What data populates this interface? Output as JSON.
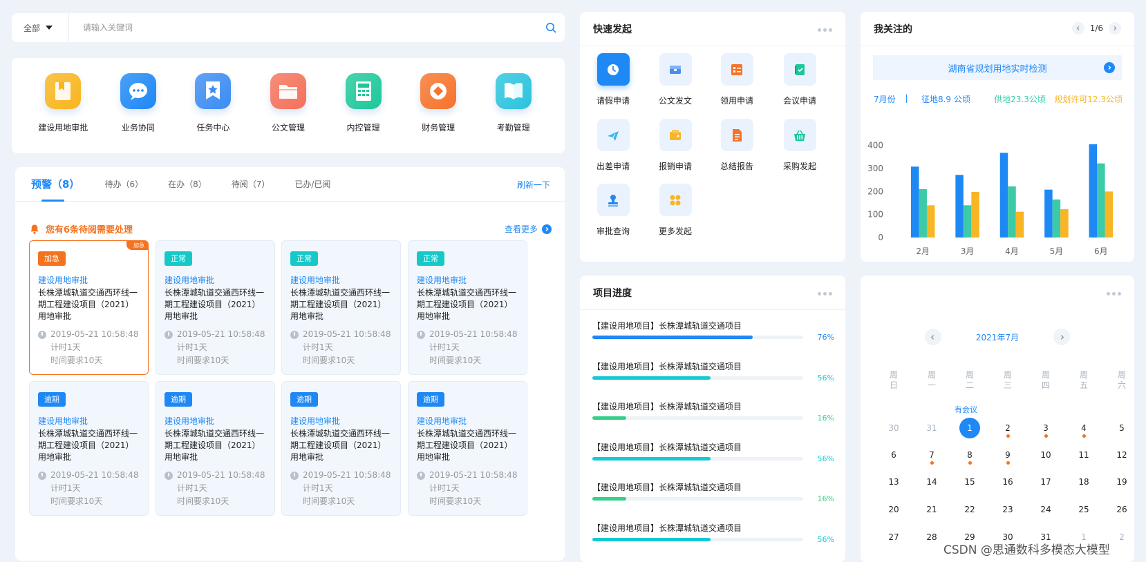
{
  "search": {
    "scope": "全部",
    "placeholder": "请输入关键词"
  },
  "apps": [
    {
      "label": "建设用地审批",
      "icon": "bookmark-icon",
      "color": "#f8b51e"
    },
    {
      "label": "业务协同",
      "icon": "chat-icon",
      "color": "#1e88f5"
    },
    {
      "label": "任务中心",
      "icon": "star-icon",
      "color": "#3b8cf3"
    },
    {
      "label": "公文管理",
      "icon": "folder-icon",
      "color": "#f4715a"
    },
    {
      "label": "内控管理",
      "icon": "calculator-icon",
      "color": "#1cc89a"
    },
    {
      "label": "财务管理",
      "icon": "coin-icon",
      "color": "#f6732b"
    },
    {
      "label": "考勤管理",
      "icon": "book-icon",
      "color": "#2ac3dd"
    }
  ],
  "tasks": {
    "tabs": [
      "预警（8）",
      "待办（6）",
      "在办（8）",
      "待阅（7）",
      "已办/已阅"
    ],
    "refresh": "刷新一下",
    "notice": "您有6条待阅需要处理",
    "more": "查看更多",
    "corner": "加急",
    "cards": [
      {
        "badge": "加急",
        "title": "建设用地审批",
        "desc": "长株潭城轨道交通西环线一期工程建设项目（2021）用地审批",
        "time": "2019-05-21 10:58:48",
        "elapsed": "计时1天",
        "req": "时间要求10天"
      },
      {
        "badge": "正常",
        "title": "建设用地审批",
        "desc": "长株潭城轨道交通西环线一期工程建设项目（2021）用地审批",
        "time": "2019-05-21 10:58:48",
        "elapsed": "计时1天",
        "req": "时间要求10天"
      },
      {
        "badge": "正常",
        "title": "建设用地审批",
        "desc": "长株潭城轨道交通西环线一期工程建设项目（2021）用地审批",
        "time": "2019-05-21 10:58:48",
        "elapsed": "计时1天",
        "req": "时间要求10天"
      },
      {
        "badge": "正常",
        "title": "建设用地审批",
        "desc": "长株潭城轨道交通西环线一期工程建设项目（2021）用地审批",
        "time": "2019-05-21 10:58:48",
        "elapsed": "计时1天",
        "req": "时间要求10天"
      },
      {
        "badge": "逾期",
        "title": "建设用地审批",
        "desc": "长株潭城轨道交通西环线一期工程建设项目（2021）用地审批",
        "time": "2019-05-21 10:58:48",
        "elapsed": "计时1天",
        "req": "时间要求10天"
      },
      {
        "badge": "逾期",
        "title": "建设用地审批",
        "desc": "长株潭城轨道交通西环线一期工程建设项目（2021）用地审批",
        "time": "2019-05-21 10:58:48",
        "elapsed": "计时1天",
        "req": "时间要求10天"
      },
      {
        "badge": "逾期",
        "title": "建设用地审批",
        "desc": "长株潭城轨道交通西环线一期工程建设项目（2021）用地审批",
        "time": "2019-05-21 10:58:48",
        "elapsed": "计时1天",
        "req": "时间要求10天"
      },
      {
        "badge": "逾期",
        "title": "建设用地审批",
        "desc": "长株潭城轨道交通西环线一期工程建设项目（2021）用地审批",
        "time": "2019-05-21 10:58:48",
        "elapsed": "计时1天",
        "req": "时间要求10天"
      }
    ]
  },
  "badge_colors": {
    "加急": "#f5731e",
    "正常": "#15c9c9",
    "逾期": "#1e88f5"
  },
  "quick": {
    "title": "快速发起",
    "items": [
      {
        "label": "请假申请",
        "icon": "clock-icon"
      },
      {
        "label": "公文发文",
        "icon": "inbox-icon"
      },
      {
        "label": "领用申请",
        "icon": "checklist-icon"
      },
      {
        "label": "会议申请",
        "icon": "notebook-icon"
      },
      {
        "label": "出差申请",
        "icon": "plane-icon"
      },
      {
        "label": "报销申请",
        "icon": "wallet-icon"
      },
      {
        "label": "总结报告",
        "icon": "document-icon"
      },
      {
        "label": "采购发起",
        "icon": "basket-icon"
      },
      {
        "label": "审批查询",
        "icon": "stamp-icon"
      },
      {
        "label": "更多发起",
        "icon": "grid-icon"
      }
    ]
  },
  "follow": {
    "title": "我关注的",
    "page": "1/6",
    "banner": "湖南省规划用地实时检测",
    "stats": {
      "month": "7月份",
      "sep": "|",
      "a": "征地8.9 公顷",
      "b": "供地23.3公顷",
      "c": "规划许可12.3公顷"
    }
  },
  "chart_data": {
    "type": "bar",
    "categories": [
      "2月",
      "3月",
      "4月",
      "5月",
      "6月"
    ],
    "series": [
      {
        "values": [
          308,
          272,
          368,
          208,
          405
        ],
        "color": "#1e88f5"
      },
      {
        "values": [
          210,
          140,
          222,
          165,
          322
        ],
        "color": "#3ccaa8"
      },
      {
        "values": [
          140,
          198,
          112,
          123,
          200
        ],
        "color": "#f8b524"
      }
    ],
    "yticks": [
      0,
      100,
      200,
      300,
      400
    ],
    "ylim": [
      0,
      420
    ]
  },
  "progress": {
    "title": "项目进度",
    "items": [
      {
        "label": "【建设用地项目】长株潭城轨道交通项目",
        "value": 76,
        "text": "76%",
        "color": "#1e88f5"
      },
      {
        "label": "【建设用地项目】长株潭城轨道交通项目",
        "value": 56,
        "text": "56%",
        "color": "#15c9d4"
      },
      {
        "label": "【建设用地项目】长株潭城轨道交通项目",
        "value": 16,
        "text": "16%",
        "color": "#34d08a"
      },
      {
        "label": "【建设用地项目】长株潭城轨道交通项目",
        "value": 56,
        "text": "56%",
        "color": "#15c9d4"
      },
      {
        "label": "【建设用地项目】长株潭城轨道交通项目",
        "value": 16,
        "text": "16%",
        "color": "#34d08a"
      },
      {
        "label": "【建设用地项目】长株潭城轨道交通项目",
        "value": 56,
        "text": "56%",
        "color": "#15c9d4"
      }
    ]
  },
  "calendar": {
    "month": "2021年7月",
    "weekdays": [
      [
        "周",
        "日"
      ],
      [
        "周",
        "一"
      ],
      [
        "周",
        "二"
      ],
      [
        "周",
        "三"
      ],
      [
        "周",
        "四"
      ],
      [
        "周",
        "五"
      ],
      [
        "周",
        "六"
      ]
    ],
    "meeting": "有会议",
    "weeks": [
      [
        {
          "d": "30",
          "dim": true
        },
        {
          "d": "31",
          "dim": true
        },
        {
          "d": "1",
          "sel": true
        },
        {
          "d": "2",
          "ev": true
        },
        {
          "d": "3",
          "ev": true
        },
        {
          "d": "4",
          "ev": true
        },
        {
          "d": "5"
        }
      ],
      [
        {
          "d": "6"
        },
        {
          "d": "7",
          "ev": true
        },
        {
          "d": "8",
          "ev": true
        },
        {
          "d": "9",
          "ev": true
        },
        {
          "d": "10"
        },
        {
          "d": "11"
        },
        {
          "d": "12"
        }
      ],
      [
        {
          "d": "13"
        },
        {
          "d": "14"
        },
        {
          "d": "15"
        },
        {
          "d": "16"
        },
        {
          "d": "17"
        },
        {
          "d": "18"
        },
        {
          "d": "19"
        }
      ],
      [
        {
          "d": "20"
        },
        {
          "d": "21"
        },
        {
          "d": "22"
        },
        {
          "d": "23"
        },
        {
          "d": "24"
        },
        {
          "d": "25"
        },
        {
          "d": "26"
        }
      ],
      [
        {
          "d": "27"
        },
        {
          "d": "28"
        },
        {
          "d": "29"
        },
        {
          "d": "30"
        },
        {
          "d": "31"
        },
        {
          "d": "1",
          "dim": true
        },
        {
          "d": "2",
          "dim": true
        }
      ]
    ]
  },
  "watermark": "CSDN @思通数科多模态大模型"
}
